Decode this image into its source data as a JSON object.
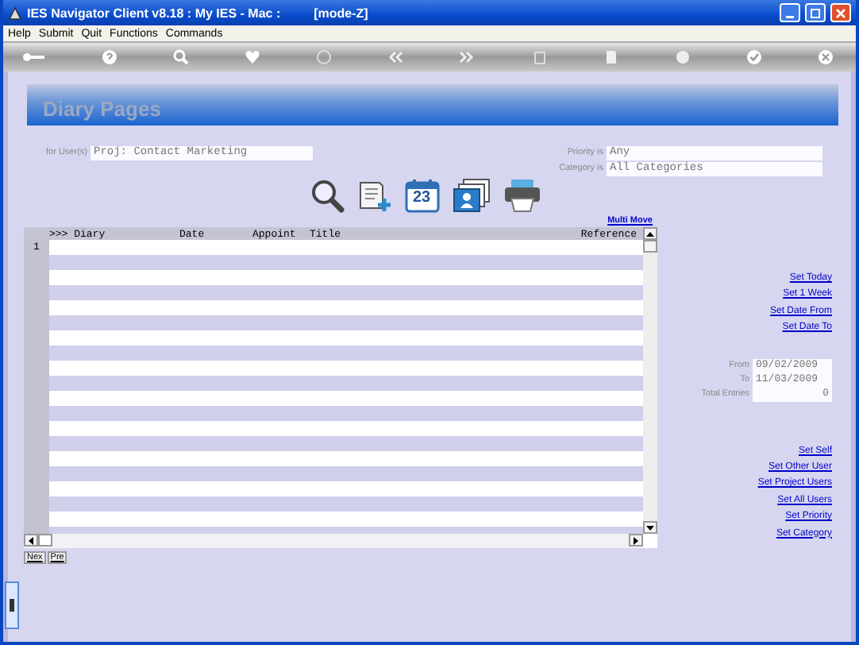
{
  "window": {
    "title": "IES Navigator Client v8.18 : My IES - Mac :",
    "mode": "[mode-Z]"
  },
  "menu": [
    "Help",
    "Submit",
    "Quit",
    "Functions",
    "Commands"
  ],
  "page_title": "Diary Pages",
  "filters": {
    "user": {
      "label": "for User(s)",
      "value": "Proj: Contact Marketing"
    },
    "priority": {
      "label": "Priority is",
      "value": "Any"
    },
    "category": {
      "label": "Category is",
      "value": "All Categories"
    }
  },
  "calendar_day": "23",
  "multi_move": "Multi Move",
  "table": {
    "columns": [
      ">>> Diary",
      "Date",
      "Appoint",
      "Title",
      "Reference"
    ],
    "rows": [
      {
        "number": "1"
      }
    ]
  },
  "pager": [
    "Nex",
    "Pre"
  ],
  "date_links": [
    "Set Today",
    "Set 1 Week",
    "Set Date From",
    "Set Date To"
  ],
  "range": [
    {
      "label": "From",
      "value": "09/02/2009"
    },
    {
      "label": "To",
      "value": "11/03/2009"
    },
    {
      "label": "Total Entries",
      "value": "0"
    }
  ],
  "user_links": [
    "Set Self",
    "Set Other User",
    "Set Project Users",
    "Set All Users",
    "Set Priority",
    "Set Category"
  ]
}
